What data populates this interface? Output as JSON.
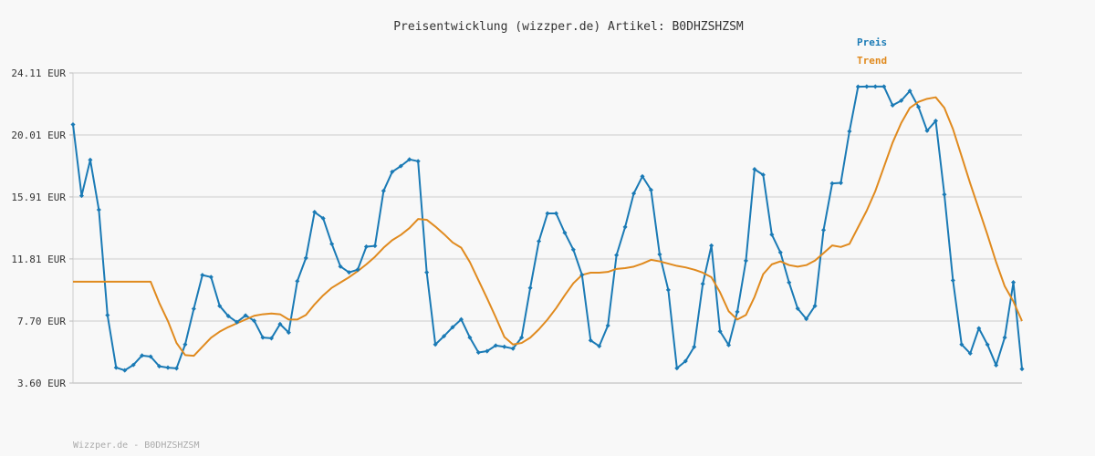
{
  "chart_data": {
    "type": "line",
    "title": "Preisentwicklung (wizzper.de) Artikel: B0DHZSHZSM",
    "ylim": [
      3.6,
      24.11
    ],
    "ytick_labels": [
      "24.11 EUR",
      "20.01 EUR",
      "15.91 EUR",
      "11.81 EUR",
      "7.70 EUR",
      "3.60 EUR"
    ],
    "ytick_values": [
      24.11,
      20.01,
      15.91,
      11.81,
      7.7,
      3.6
    ],
    "grid": true,
    "legend_position": "top-right",
    "series": [
      {
        "name": "Preis",
        "color": "#1a7ab5",
        "markers": true,
        "values": [
          20.7,
          15.99,
          18.36,
          15.06,
          8.09,
          4.62,
          4.44,
          4.8,
          5.42,
          5.35,
          4.71,
          4.62,
          4.57,
          6.15,
          8.51,
          10.74,
          10.61,
          8.7,
          8.03,
          7.63,
          8.07,
          7.72,
          6.61,
          6.56,
          7.5,
          6.94,
          10.34,
          11.87,
          14.91,
          14.49,
          12.8,
          11.31,
          10.92,
          11.1,
          12.62,
          12.67,
          16.31,
          17.57,
          17.95,
          18.39,
          18.27,
          10.92,
          6.15,
          6.7,
          7.29,
          7.81,
          6.61,
          5.62,
          5.71,
          6.08,
          6.0,
          5.88,
          6.61,
          9.89,
          12.98,
          14.82,
          14.82,
          13.54,
          12.42,
          10.75,
          6.42,
          6.04,
          7.4,
          12.06,
          13.92,
          16.14,
          17.27,
          16.37,
          12.11,
          9.76,
          4.58,
          5.05,
          5.99,
          10.16,
          12.69,
          7.02,
          6.11,
          8.31,
          11.69,
          17.74,
          17.37,
          13.42,
          12.24,
          10.25,
          8.53,
          7.84,
          8.7,
          13.72,
          16.8,
          16.84,
          20.25,
          23.2,
          23.21,
          23.21,
          23.21,
          21.97,
          22.28,
          22.92,
          21.86,
          20.29,
          20.94,
          16.07,
          10.39,
          6.15,
          5.56,
          7.22,
          6.14,
          4.78,
          6.61,
          10.26,
          4.53
        ]
      },
      {
        "name": "Trend",
        "color": "#e08a1e",
        "markers": false,
        "values": [
          10.3,
          10.3,
          10.3,
          10.3,
          10.3,
          10.3,
          10.3,
          10.3,
          10.3,
          10.3,
          8.9,
          7.7,
          6.25,
          5.45,
          5.4,
          6.0,
          6.6,
          7.0,
          7.3,
          7.55,
          7.8,
          8.05,
          8.15,
          8.2,
          8.15,
          7.8,
          7.8,
          8.1,
          8.8,
          9.4,
          9.9,
          10.25,
          10.6,
          11.0,
          11.45,
          11.95,
          12.55,
          13.05,
          13.4,
          13.85,
          14.45,
          14.4,
          13.95,
          13.45,
          12.9,
          12.55,
          11.6,
          10.4,
          9.2,
          7.95,
          6.65,
          6.15,
          6.25,
          6.6,
          7.15,
          7.8,
          8.55,
          9.4,
          10.2,
          10.75,
          10.9,
          10.9,
          10.95,
          11.15,
          11.2,
          11.3,
          11.5,
          11.75,
          11.65,
          11.5,
          11.35,
          11.25,
          11.1,
          10.9,
          10.6,
          9.6,
          8.35,
          7.8,
          8.1,
          9.3,
          10.8,
          11.45,
          11.65,
          11.4,
          11.3,
          11.4,
          11.7,
          12.2,
          12.7,
          12.6,
          12.8,
          13.9,
          15.0,
          16.3,
          17.9,
          19.5,
          20.8,
          21.8,
          22.2,
          22.4,
          22.5,
          21.8,
          20.4,
          18.6,
          16.8,
          15.1,
          13.4,
          11.6,
          10.0,
          9.0,
          7.7
        ]
      }
    ]
  },
  "footer_text": "Wizzper.de - B0DHZSHZSM"
}
